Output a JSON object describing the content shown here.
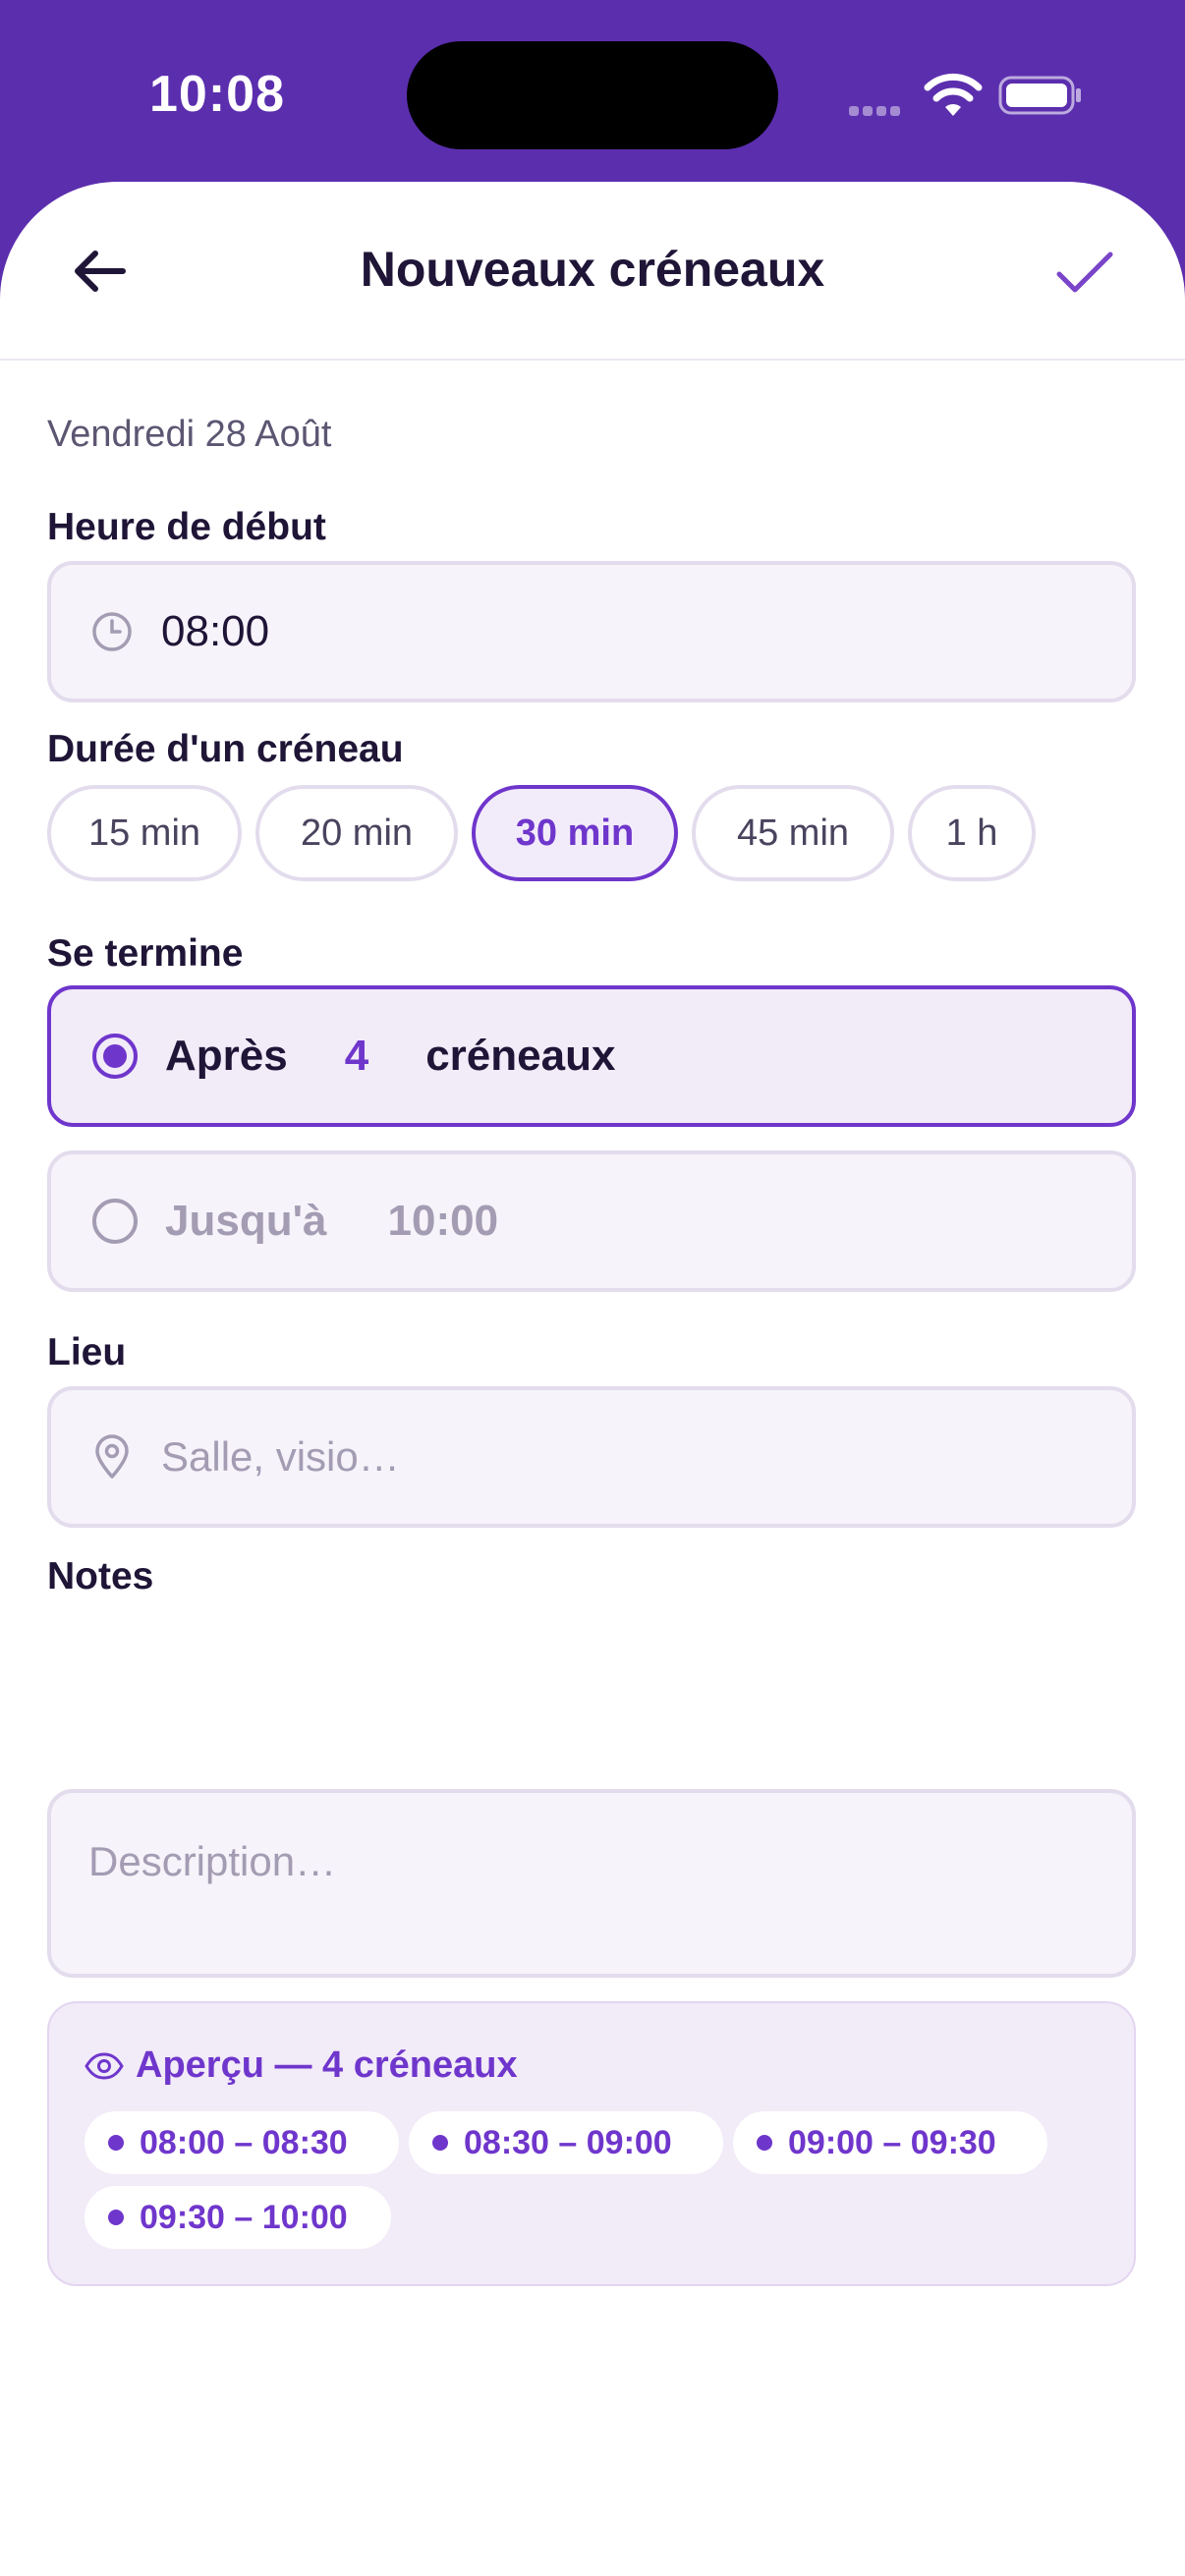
{
  "status_bar": {
    "time": "10:08",
    "wifi_icon": "wifi-icon",
    "battery_icon": "battery-icon"
  },
  "colors": {
    "accent": "#6f36cc",
    "header_bg": "#5b2eae",
    "field_bg": "#f6f3fa",
    "muted": "#a39cb3"
  },
  "nav": {
    "title": "Nouveaux créneaux",
    "back_icon": "arrow-left-icon",
    "confirm_icon": "check-icon"
  },
  "form": {
    "date": "Vendredi 28 Août",
    "start_time": {
      "label": "Heure de début",
      "value": "08:00",
      "icon": "clock-icon"
    },
    "duration": {
      "label": "Durée d'un créneau",
      "options": [
        "15 min",
        "20 min",
        "30 min",
        "45 min",
        "1 h"
      ],
      "selected": "30 min"
    },
    "ends": {
      "label": "Se termine",
      "after": {
        "prefix": "Après",
        "count": "4",
        "suffix": "créneaux",
        "selected": true
      },
      "until": {
        "prefix": "Jusqu'à",
        "time": "10:00",
        "selected": false
      }
    },
    "location": {
      "label": "Lieu",
      "placeholder": "Salle, visio…",
      "icon": "map-pin-icon"
    },
    "notes": {
      "label": "Notes",
      "placeholder": "Description…"
    }
  },
  "preview": {
    "title": "Aperçu — 4 créneaux",
    "icon": "eye-icon",
    "slots": [
      "08:00 – 08:30",
      "08:30 – 09:00",
      "09:00 – 09:30",
      "09:30 – 10:00"
    ]
  }
}
